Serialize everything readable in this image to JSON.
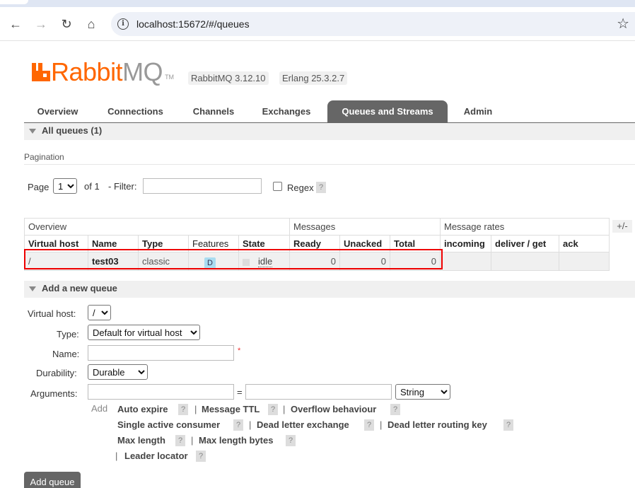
{
  "browser": {
    "url": "localhost:15672/#/queues"
  },
  "header": {
    "logo_rabbit": "Rabbit",
    "logo_mq": "MQ",
    "logo_tm": "TM",
    "version": "RabbitMQ 3.12.10",
    "erlang": "Erlang 25.3.2.7"
  },
  "tabs": [
    "Overview",
    "Connections",
    "Channels",
    "Exchanges",
    "Queues and Streams",
    "Admin"
  ],
  "active_tab": "Queues and Streams",
  "all_queues": {
    "title": "All queues (1)",
    "pagination_label": "Pagination",
    "page_label": "Page",
    "page_value": "1",
    "of_label": "of 1",
    "filter_label": "- Filter:",
    "filter_value": "",
    "regex_label": "Regex",
    "help": "?",
    "plus_minus": "+/-"
  },
  "table": {
    "groups": [
      "Overview",
      "Messages",
      "Message rates"
    ],
    "columns": [
      "Virtual host",
      "Name",
      "Type",
      "Features",
      "State",
      "Ready",
      "Unacked",
      "Total",
      "incoming",
      "deliver / get",
      "ack"
    ],
    "rows": [
      {
        "vhost": "/",
        "name": "test03",
        "type": "classic",
        "feature": "D",
        "state": "idle",
        "ready": "0",
        "unacked": "0",
        "total": "0",
        "incoming": "",
        "deliver_get": "",
        "ack": ""
      }
    ]
  },
  "add_queue": {
    "title": "Add a new queue",
    "vhost_label": "Virtual host:",
    "vhost_value": "/",
    "type_label": "Type:",
    "type_value": "Default for virtual host",
    "name_label": "Name:",
    "name_value": "",
    "required_mark": "*",
    "durability_label": "Durability:",
    "durability_value": "Durable",
    "arguments_label": "Arguments:",
    "equals": "=",
    "arg_type_value": "String",
    "add_label": "Add",
    "options": [
      "Auto expire",
      "Message TTL",
      "Overflow behaviour",
      "Single active consumer",
      "Dead letter exchange",
      "Dead letter routing key",
      "Max length",
      "Max length bytes",
      "Leader locator"
    ],
    "submit": "Add queue"
  },
  "colors": {
    "brand_orange": "#ff6600",
    "tab_active": "#666666",
    "highlight_red": "#ee0000"
  }
}
